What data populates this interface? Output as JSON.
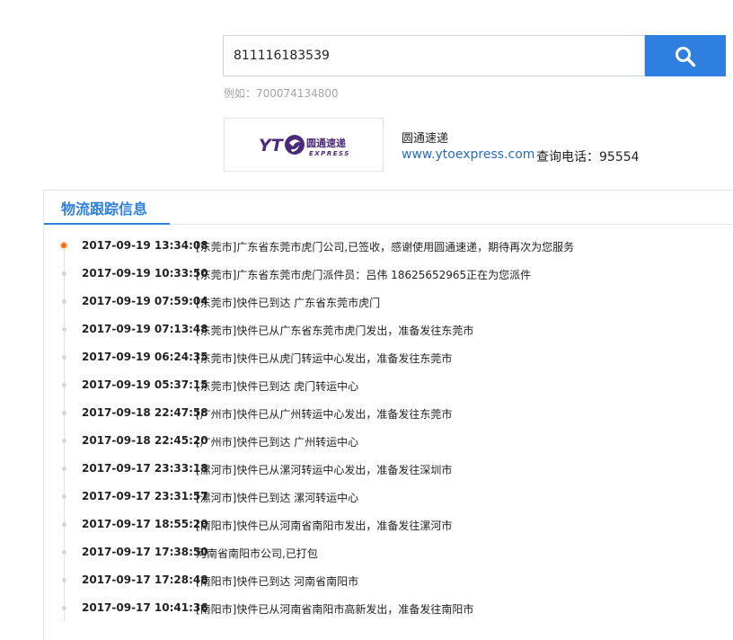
{
  "search": {
    "value": "811116183539",
    "example": "例如：700074134800"
  },
  "carrier": {
    "name": "圆通速递",
    "website": "www.ytoexpress.com",
    "phone_label": "查询电话：95554",
    "logo_text_main": "圆通速递",
    "logo_text_sub": "EXPRESS",
    "logo_prefix": "YT"
  },
  "panel": {
    "tab_label": "物流跟踪信息"
  },
  "colors": {
    "accent": "#2e7fe0",
    "link": "#2a6bc2",
    "current_dot": "#ff6a00",
    "logo_purple": "#4b2a7b"
  },
  "tracking": [
    {
      "time": "2017-09-19 13:34:08",
      "desc": "[东莞市]广东省东莞市虎门公司,已签收，感谢使用圆通速递，期待再次为您服务"
    },
    {
      "time": "2017-09-19 10:33:50",
      "desc": "[东莞市]广东省东莞市虎门派件员：吕伟 18625652965正在为您派件"
    },
    {
      "time": "2017-09-19 07:59:04",
      "desc": "[东莞市]快件已到达 广东省东莞市虎门"
    },
    {
      "time": "2017-09-19 07:13:48",
      "desc": "[东莞市]快件已从广东省东莞市虎门发出，准备发往东莞市"
    },
    {
      "time": "2017-09-19 06:24:35",
      "desc": "[东莞市]快件已从虎门转运中心发出，准备发往东莞市"
    },
    {
      "time": "2017-09-19 05:37:15",
      "desc": "[东莞市]快件已到达 虎门转运中心"
    },
    {
      "time": "2017-09-18 22:47:58",
      "desc": "[广州市]快件已从广州转运中心发出，准备发往东莞市"
    },
    {
      "time": "2017-09-18 22:45:20",
      "desc": "[广州市]快件已到达 广州转运中心"
    },
    {
      "time": "2017-09-17 23:33:18",
      "desc": "[漯河市]快件已从漯河转运中心发出，准备发往深圳市"
    },
    {
      "time": "2017-09-17 23:31:57",
      "desc": "[漯河市]快件已到达 漯河转运中心"
    },
    {
      "time": "2017-09-17 18:55:20",
      "desc": "[南阳市]快件已从河南省南阳市发出，准备发往漯河市"
    },
    {
      "time": "2017-09-17 17:38:50",
      "desc": "河南省南阳市公司,已打包"
    },
    {
      "time": "2017-09-17 17:28:48",
      "desc": "[南阳市]快件已到达 河南省南阳市"
    },
    {
      "time": "2017-09-17 10:41:36",
      "desc": "[南阳市]快件已从河南省南阳市高新发出，准备发往南阳市"
    }
  ]
}
